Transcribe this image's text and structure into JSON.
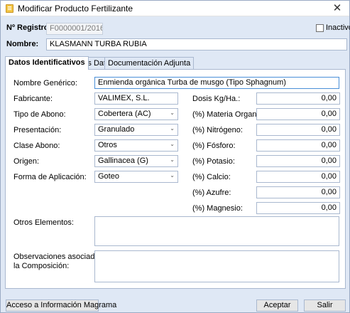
{
  "window": {
    "title": "Modificar Producto Fertilizante"
  },
  "header": {
    "registro_label": "Nº Registro:",
    "registro_value": "F0000001/2016",
    "inactivo_label": "Inactivo",
    "nombre_label": "Nombre:",
    "nombre_value": "KLASMANN TURBA RUBIA"
  },
  "tabs": [
    {
      "label": "Datos Identificativos",
      "active": true
    },
    {
      "label": "Otros Datos",
      "active": false
    },
    {
      "label": "Documentación Adjunta",
      "active": false
    }
  ],
  "form": {
    "nombre_generico": {
      "label": "Nombre Genérico:",
      "value": "Enmienda orgánica Turba de musgo (Tipo Sphagnum)"
    },
    "fabricante": {
      "label": "Fabricante:",
      "value": "VALIMEX, S.L."
    },
    "tipo_abono": {
      "label": "Tipo de Abono:",
      "value": "Cobertera (AC)"
    },
    "presentacion": {
      "label": "Presentación:",
      "value": "Granulado"
    },
    "clase_abono": {
      "label": "Clase Abono:",
      "value": "Otros"
    },
    "origen": {
      "label": "Origen:",
      "value": "Gallinacea (G)"
    },
    "forma_aplicacion": {
      "label": "Forma de Aplicación:",
      "value": "Goteo"
    },
    "otros_elementos": {
      "label": "Otros Elementos:"
    },
    "observaciones": {
      "label_line1": "Observaciones asociadas a",
      "label_line2": "la Composición:"
    }
  },
  "composition": [
    {
      "label": "Dosis Kg/Ha.:",
      "value": "0,00"
    },
    {
      "label": "(%) Materia Organica:",
      "value": "0,00"
    },
    {
      "label": "(%) Nitrógeno:",
      "value": "0,00"
    },
    {
      "label": "(%) Fósforo:",
      "value": "0,00"
    },
    {
      "label": "(%) Potasio:",
      "value": "0,00"
    },
    {
      "label": "(%) Calcio:",
      "value": "0,00"
    },
    {
      "label": "(%) Azufre:",
      "value": "0,00"
    },
    {
      "label": "(%) Magnesio:",
      "value": "0,00"
    }
  ],
  "footer": {
    "magrama_button": "Acceso a Información Magrama",
    "accept_button": "Aceptar",
    "exit_button": "Salir"
  },
  "icons": {
    "close": "✕",
    "chevron": "⌄"
  }
}
